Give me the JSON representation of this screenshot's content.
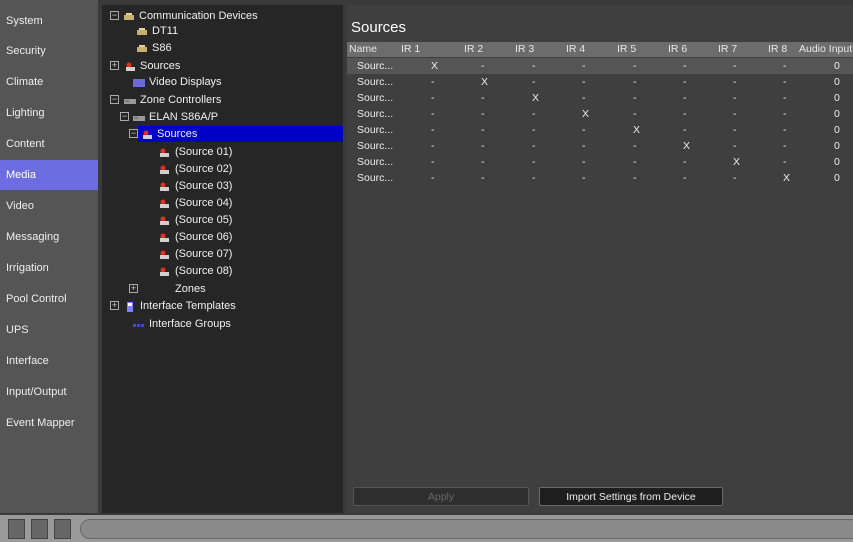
{
  "nav": {
    "items": [
      "System",
      "Security",
      "Climate",
      "Lighting",
      "Content",
      "Media",
      "Video",
      "Messaging",
      "Irrigation",
      "Pool Control",
      "UPS",
      "Interface",
      "Input/Output",
      "Event Mapper"
    ],
    "active": "Media"
  },
  "tree": [
    {
      "label": "Communication Devices",
      "expander": "−",
      "icon": "communication-device-icon"
    },
    {
      "label": "DT11",
      "expander": "",
      "icon": "communication-device-icon"
    },
    {
      "label": "S86",
      "expander": "",
      "icon": "communication-device-icon"
    },
    {
      "label": "Sources",
      "expander": "+",
      "icon": "source-icon"
    },
    {
      "label": "Video Displays",
      "expander": "",
      "icon": "display-icon"
    },
    {
      "label": "Zone Controllers",
      "expander": "−",
      "icon": "controller-icon"
    },
    {
      "label": "ELAN S86A/P",
      "expander": "−",
      "icon": "controller-icon"
    },
    {
      "label": "Sources",
      "expander": "−",
      "icon": "source-icon",
      "selected": true
    },
    {
      "label": "(Source 01)",
      "expander": "",
      "icon": "source-icon"
    },
    {
      "label": "(Source 02)",
      "expander": "",
      "icon": "source-icon"
    },
    {
      "label": "(Source 03)",
      "expander": "",
      "icon": "source-icon"
    },
    {
      "label": "(Source 04)",
      "expander": "",
      "icon": "source-icon"
    },
    {
      "label": "(Source 05)",
      "expander": "",
      "icon": "source-icon"
    },
    {
      "label": "(Source 06)",
      "expander": "",
      "icon": "source-icon"
    },
    {
      "label": "(Source 07)",
      "expander": "",
      "icon": "source-icon"
    },
    {
      "label": "(Source 08)",
      "expander": "",
      "icon": "source-icon"
    },
    {
      "label": "Zones",
      "expander": "+",
      "icon": ""
    },
    {
      "label": "Interface Templates",
      "expander": "+",
      "icon": "template-icon"
    },
    {
      "label": "Interface Groups",
      "expander": "",
      "icon": "group-icon"
    }
  ],
  "main": {
    "title": "Sources",
    "columns": [
      "Name",
      "IR 1",
      "IR 2",
      "IR 3",
      "IR 4",
      "IR 5",
      "IR 6",
      "IR 7",
      "IR 8",
      "Audio Input"
    ],
    "rows": [
      [
        "Sourc...",
        "X",
        "-",
        "-",
        "-",
        "-",
        "-",
        "-",
        "-",
        "0"
      ],
      [
        "Sourc...",
        "-",
        "X",
        "-",
        "-",
        "-",
        "-",
        "-",
        "-",
        "0"
      ],
      [
        "Sourc...",
        "-",
        "-",
        "X",
        "-",
        "-",
        "-",
        "-",
        "-",
        "0"
      ],
      [
        "Sourc...",
        "-",
        "-",
        "-",
        "X",
        "-",
        "-",
        "-",
        "-",
        "0"
      ],
      [
        "Sourc...",
        "-",
        "-",
        "-",
        "-",
        "X",
        "-",
        "-",
        "-",
        "0"
      ],
      [
        "Sourc...",
        "-",
        "-",
        "-",
        "-",
        "-",
        "X",
        "-",
        "-",
        "0"
      ],
      [
        "Sourc...",
        "-",
        "-",
        "-",
        "-",
        "-",
        "-",
        "X",
        "-",
        "0"
      ],
      [
        "Sourc...",
        "-",
        "-",
        "-",
        "-",
        "-",
        "-",
        "-",
        "X",
        "0"
      ]
    ],
    "apply_label": "Apply",
    "import_label": "Import Settings from Device"
  }
}
